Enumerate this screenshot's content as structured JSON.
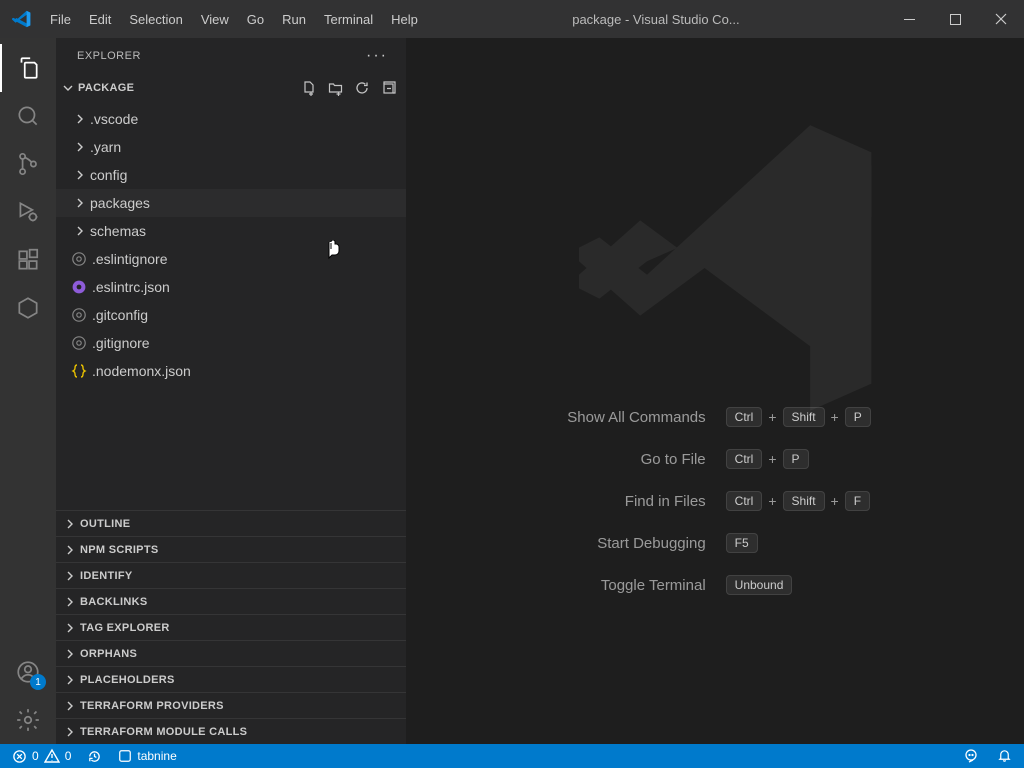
{
  "title": "package - Visual Studio Co...",
  "menu": [
    "File",
    "Edit",
    "Selection",
    "View",
    "Go",
    "Run",
    "Terminal",
    "Help"
  ],
  "sidebar_title": "EXPLORER",
  "root_folder": "PACKAGE",
  "tree": [
    {
      "name": ".vscode",
      "kind": "folder"
    },
    {
      "name": ".yarn",
      "kind": "folder"
    },
    {
      "name": "config",
      "kind": "folder"
    },
    {
      "name": "packages",
      "kind": "folder",
      "hover": true
    },
    {
      "name": "schemas",
      "kind": "folder"
    },
    {
      "name": ".eslintignore",
      "kind": "file",
      "icon": "gear-gray"
    },
    {
      "name": ".eslintrc.json",
      "kind": "file",
      "icon": "gear-purple"
    },
    {
      "name": ".gitconfig",
      "kind": "file",
      "icon": "gear-gray"
    },
    {
      "name": ".gitignore",
      "kind": "file",
      "icon": "gear-gray"
    },
    {
      "name": ".nodemonx.json",
      "kind": "file",
      "icon": "braces-yellow"
    }
  ],
  "panels": [
    "OUTLINE",
    "NPM SCRIPTS",
    "IDENTIFY",
    "BACKLINKS",
    "TAG EXPLORER",
    "ORPHANS",
    "PLACEHOLDERS",
    "TERRAFORM PROVIDERS",
    "TERRAFORM MODULE CALLS"
  ],
  "shortcuts": [
    {
      "label": "Show All Commands",
      "keys": [
        "Ctrl",
        "+",
        "Shift",
        "+",
        "P"
      ]
    },
    {
      "label": "Go to File",
      "keys": [
        "Ctrl",
        "+",
        "P"
      ]
    },
    {
      "label": "Find in Files",
      "keys": [
        "Ctrl",
        "+",
        "Shift",
        "+",
        "F"
      ]
    },
    {
      "label": "Start Debugging",
      "keys": [
        "F5"
      ]
    },
    {
      "label": "Toggle Terminal",
      "keys": [
        "Unbound"
      ]
    }
  ],
  "status": {
    "errors": "0",
    "warnings": "0",
    "tabnine": "tabnine"
  },
  "accounts_badge": "1"
}
